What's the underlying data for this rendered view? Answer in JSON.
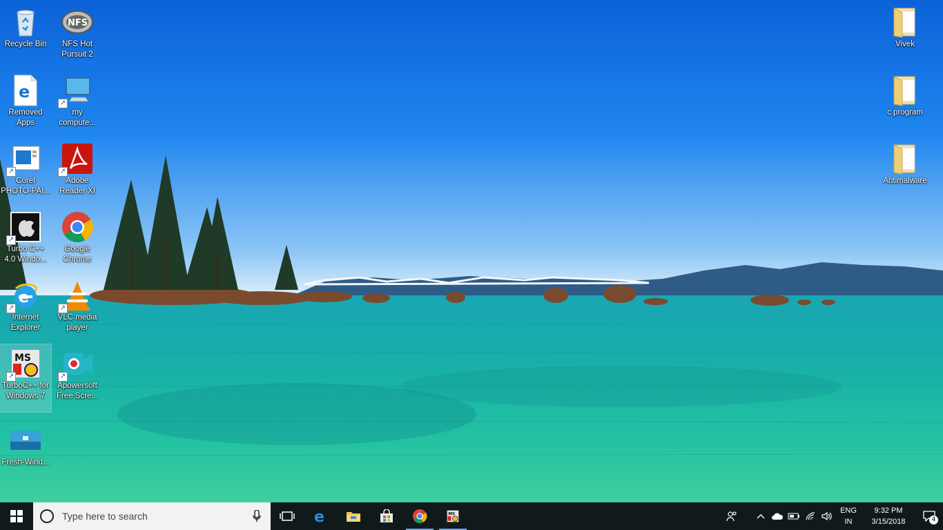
{
  "desktop": {
    "left_column_1": [
      {
        "label": "Recycle Bin",
        "icon": "recycle-bin-icon"
      },
      {
        "label": "Removed Apps",
        "icon": "edge-file-icon"
      },
      {
        "label": "Corel PHOTO-PAI...",
        "icon": "corel-icon"
      },
      {
        "label": "Turbo C++ 4.0 Windo...",
        "icon": "apple-logo-icon"
      },
      {
        "label": "Internet Explorer",
        "icon": "internet-explorer-icon"
      },
      {
        "label": "TurboC++ for Windows 7",
        "icon": "turbo-c-icon"
      },
      {
        "label": "Fresh-Wind...",
        "icon": "image-thumbnail-icon"
      }
    ],
    "left_column_2": [
      {
        "label": "NFS Hot Pursuit 2",
        "icon": "nfs-icon"
      },
      {
        "label": "my compute...",
        "icon": "computer-icon"
      },
      {
        "label": "Adobe Reader XI",
        "icon": "adobe-reader-icon"
      },
      {
        "label": "Google Chrome",
        "icon": "chrome-icon"
      },
      {
        "label": "VLC media player",
        "icon": "vlc-icon"
      },
      {
        "label": "Apowersoft Free Scre...",
        "icon": "apowersoft-icon"
      }
    ],
    "right_column": [
      {
        "label": "Vivek",
        "icon": "folder-icon"
      },
      {
        "label": "c program",
        "icon": "folder-icon"
      },
      {
        "label": "Antimalware",
        "icon": "folder-icon"
      }
    ]
  },
  "taskbar": {
    "search_placeholder": "Type here to search",
    "pinned": [
      "task-view-icon",
      "edge-icon",
      "file-explorer-icon",
      "store-icon",
      "chrome-icon",
      "turbo-c-icon"
    ],
    "tray": {
      "lang_line1": "ENG",
      "lang_line2": "IN",
      "time": "9:32 PM",
      "date": "3/15/2018",
      "notification_count": "4"
    }
  }
}
